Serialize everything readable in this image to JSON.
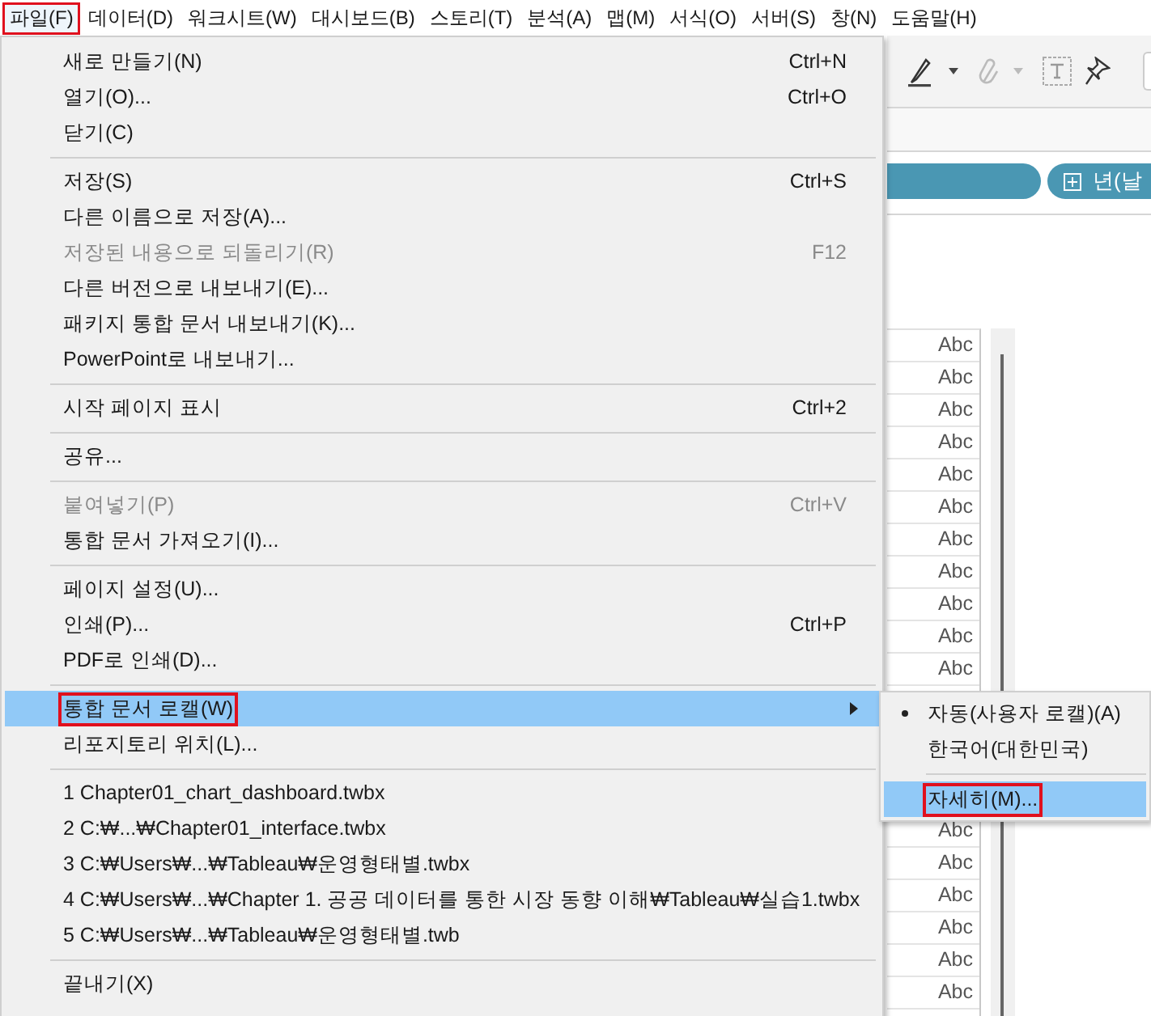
{
  "menubar": [
    {
      "label": "파일(F)",
      "selected": true,
      "annotated": true
    },
    {
      "label": "데이터(D)",
      "selected": false,
      "annotated": false
    },
    {
      "label": "워크시트(W)",
      "selected": false,
      "annotated": false
    },
    {
      "label": "대시보드(B)",
      "selected": false,
      "annotated": false
    },
    {
      "label": "스토리(T)",
      "selected": false,
      "annotated": false
    },
    {
      "label": "분석(A)",
      "selected": false,
      "annotated": false
    },
    {
      "label": "맵(M)",
      "selected": false,
      "annotated": false
    },
    {
      "label": "서식(O)",
      "selected": false,
      "annotated": false
    },
    {
      "label": "서버(S)",
      "selected": false,
      "annotated": false
    },
    {
      "label": "창(N)",
      "selected": false,
      "annotated": false
    },
    {
      "label": "도움말(H)",
      "selected": false,
      "annotated": false
    }
  ],
  "file_menu": {
    "groups": [
      [
        {
          "label": "새로 만들기(N)",
          "shortcut": "Ctrl+N",
          "kind": "item",
          "disabled": false,
          "selected": false,
          "annotated": false
        },
        {
          "label": "열기(O)...",
          "shortcut": "Ctrl+O",
          "kind": "item",
          "disabled": false,
          "selected": false,
          "annotated": false
        },
        {
          "label": "닫기(C)",
          "kind": "item",
          "disabled": false,
          "selected": false,
          "annotated": false
        }
      ],
      [
        {
          "label": "저장(S)",
          "shortcut": "Ctrl+S",
          "kind": "item",
          "disabled": false,
          "selected": false,
          "annotated": false
        },
        {
          "label": "다른 이름으로 저장(A)...",
          "kind": "item",
          "disabled": false,
          "selected": false,
          "annotated": false
        },
        {
          "label": "저장된 내용으로 되돌리기(R)",
          "shortcut": "F12",
          "kind": "item",
          "disabled": true,
          "selected": false,
          "annotated": false
        },
        {
          "label": "다른 버전으로 내보내기(E)...",
          "kind": "item",
          "disabled": false,
          "selected": false,
          "annotated": false
        },
        {
          "label": "패키지 통합 문서 내보내기(K)...",
          "kind": "item",
          "disabled": false,
          "selected": false,
          "annotated": false
        },
        {
          "label": "PowerPoint로 내보내기...",
          "kind": "item",
          "disabled": false,
          "selected": false,
          "annotated": false
        }
      ],
      [
        {
          "label": "시작 페이지 표시",
          "shortcut": "Ctrl+2",
          "kind": "item",
          "disabled": false,
          "selected": false,
          "annotated": false
        }
      ],
      [
        {
          "label": "공유...",
          "kind": "item",
          "disabled": false,
          "selected": false,
          "annotated": false
        }
      ],
      [
        {
          "label": "붙여넣기(P)",
          "shortcut": "Ctrl+V",
          "kind": "item",
          "disabled": true,
          "selected": false,
          "annotated": false
        },
        {
          "label": "통합 문서 가져오기(I)...",
          "kind": "item",
          "disabled": false,
          "selected": false,
          "annotated": false
        }
      ],
      [
        {
          "label": "페이지 설정(U)...",
          "kind": "item",
          "disabled": false,
          "selected": false,
          "annotated": false
        },
        {
          "label": "인쇄(P)...",
          "shortcut": "Ctrl+P",
          "kind": "item",
          "disabled": false,
          "selected": false,
          "annotated": false
        },
        {
          "label": "PDF로 인쇄(D)...",
          "kind": "item",
          "disabled": false,
          "selected": false,
          "annotated": false
        }
      ],
      [
        {
          "label": "통합 문서 로캘(W)",
          "kind": "submenu",
          "disabled": false,
          "selected": true,
          "annotated": true
        },
        {
          "label": "리포지토리 위치(L)...",
          "kind": "item",
          "disabled": false,
          "selected": false,
          "annotated": false
        }
      ],
      [
        {
          "label": "1 Chapter01_chart_dashboard.twbx",
          "kind": "item",
          "disabled": false,
          "selected": false,
          "annotated": false
        },
        {
          "label": "2 C:₩...₩Chapter01_interface.twbx",
          "kind": "item",
          "disabled": false,
          "selected": false,
          "annotated": false
        },
        {
          "label": "3 C:₩Users₩...₩Tableau₩운영형태별.twbx",
          "kind": "item",
          "disabled": false,
          "selected": false,
          "annotated": false
        },
        {
          "label": "4 C:₩Users₩...₩Chapter 1. 공공 데이터를 통한 시장 동향 이해₩Tableau₩실습1.twbx",
          "kind": "item",
          "disabled": false,
          "selected": false,
          "annotated": false
        },
        {
          "label": "5 C:₩Users₩...₩Tableau₩운영형태별.twb",
          "kind": "item",
          "disabled": false,
          "selected": false,
          "annotated": false
        }
      ],
      [
        {
          "label": "끝내기(X)",
          "kind": "item",
          "disabled": false,
          "selected": false,
          "annotated": false
        }
      ]
    ]
  },
  "locale_submenu": {
    "groups": [
      [
        {
          "label": "자동(사용자 로캘)(A)",
          "checked": true,
          "selected": false,
          "annotated": false
        },
        {
          "label": "한국어(대한민국)",
          "checked": false,
          "selected": false,
          "annotated": false
        }
      ],
      [
        {
          "label": "자세히(M)...",
          "checked": false,
          "selected": true,
          "annotated": true
        }
      ]
    ]
  },
  "shelf": {
    "pill_label": "년(날"
  },
  "table": {
    "cells_above": [
      "Abc",
      "Abc",
      "Abc",
      "Abc",
      "Abc",
      "Abc",
      "Abc",
      "Abc",
      "Abc",
      "Abc",
      "Abc"
    ],
    "cells_below": [
      "Abc",
      "Abc",
      "Abc",
      "Abc",
      "Abc",
      "Abc"
    ]
  }
}
